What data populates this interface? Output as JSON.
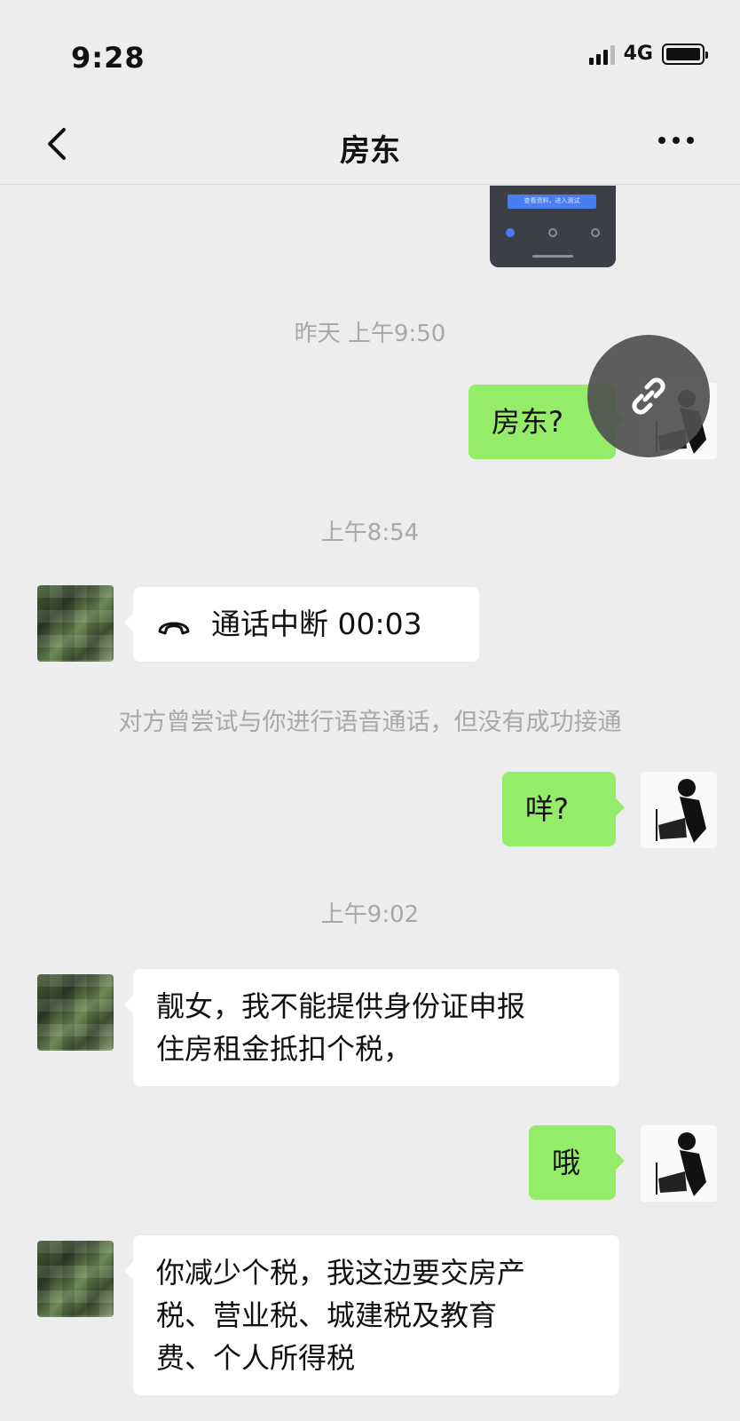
{
  "status_bar": {
    "time": "9:28",
    "network": "4G"
  },
  "nav": {
    "title": "房东",
    "back_icon": "chevron-left-icon",
    "more_icon": "ellipsis-icon"
  },
  "colors": {
    "background": "#ededed",
    "self_bubble": "#95ec69",
    "other_bubble": "#ffffff",
    "timestamp": "#a8a8a8"
  },
  "messages": {
    "ts1": "昨天 上午9:50",
    "m1": "房东?",
    "ts2": "上午8:54",
    "call": "通话中断 00:03",
    "call_note": "对方曾尝试与你进行语音通话，但没有成功接通",
    "m3": "咩?",
    "ts3": "上午9:02",
    "m4_line1": "靓女，我不能提供身份证申报",
    "m4_line2": "住房租金抵扣个税，",
    "m5": "哦",
    "m6_line1": "你减少个税，我这边要交房产",
    "m6_line2": "税、营业税、城建税及教育",
    "m6_line3": "费、个人所得税"
  },
  "screenshot_thumb": {
    "button_text": "查看资料，进入测试"
  }
}
